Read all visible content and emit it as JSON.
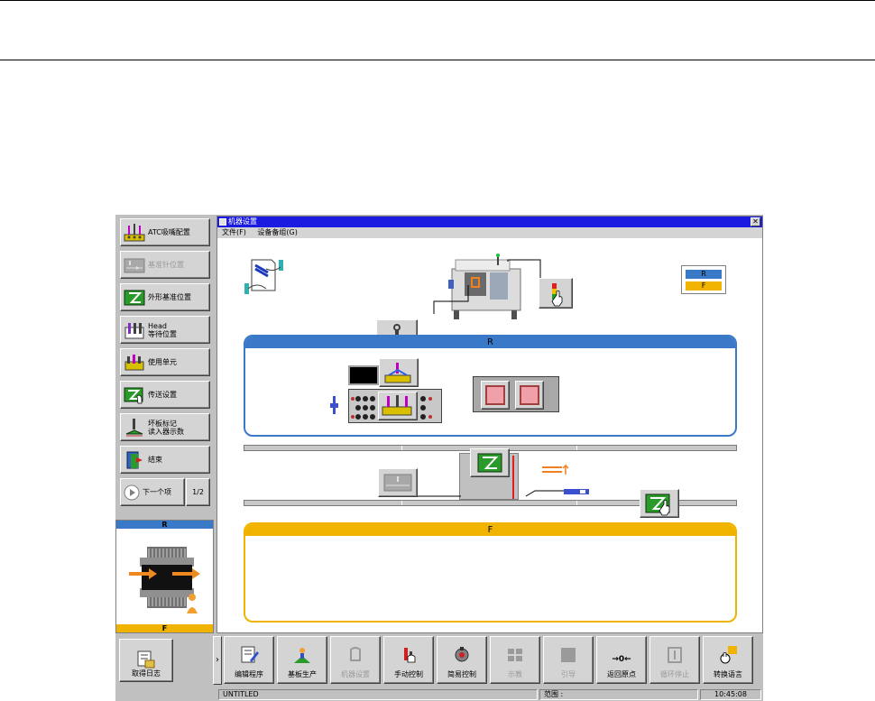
{
  "window": {
    "title": "机器设置",
    "close_glyph": "✕",
    "menu": [
      "文件(F)",
      "设备备组(G)"
    ]
  },
  "sidebar": {
    "items": [
      {
        "label": "ATC吸嘴配置",
        "icon": "nozzle-icon",
        "enabled": true
      },
      {
        "label": "基准针位置",
        "icon": "pin-icon",
        "enabled": false
      },
      {
        "label": "外形基准位置",
        "icon": "z-board-icon",
        "enabled": true
      },
      {
        "label": "Head\n等待位置",
        "icon": "head-icon",
        "enabled": true
      },
      {
        "label": "使用单元",
        "icon": "unit-icon",
        "enabled": true
      },
      {
        "label": "传送设置",
        "icon": "conveyor-icon",
        "enabled": true
      },
      {
        "label": "坏板标记\n读入器示数",
        "icon": "bad-mark-icon",
        "enabled": true
      },
      {
        "label": "结束",
        "icon": "exit-icon",
        "enabled": true
      }
    ],
    "next_label": "下一个项",
    "page_indicator": "1/2"
  },
  "preview": {
    "top_label": "R",
    "bottom_label": "F"
  },
  "legend": {
    "r": "R",
    "f": "F"
  },
  "panels": {
    "r_label": "R",
    "f_label": "F"
  },
  "toolbar": {
    "log_label": "取得日志",
    "arrow_glyph": "›",
    "buttons": [
      {
        "label": "编辑程序",
        "icon": "edit-program-icon",
        "enabled": true
      },
      {
        "label": "基板生产",
        "icon": "production-icon",
        "enabled": true
      },
      {
        "label": "机器设置",
        "icon": "machine-setup-icon",
        "enabled": false
      },
      {
        "label": "手动控制",
        "icon": "manual-control-icon",
        "enabled": true
      },
      {
        "label": "简易控制",
        "icon": "simple-control-icon",
        "enabled": true
      },
      {
        "label": "示教",
        "icon": "teach-icon",
        "enabled": false
      },
      {
        "label": "引导",
        "icon": "guide-icon",
        "enabled": false
      },
      {
        "label": "返回原点",
        "icon": "origin-return-icon",
        "enabled": true
      },
      {
        "label": "循环停止",
        "icon": "cycle-stop-icon",
        "enabled": false
      },
      {
        "label": "转换语言",
        "icon": "language-icon",
        "enabled": true
      }
    ],
    "origin_glyph": "→0←"
  },
  "status": {
    "program": "UNTITLED",
    "range_label": "范围 :",
    "time": "10:45:08"
  },
  "colors": {
    "r_blue": "#3a78c8",
    "f_yellow": "#f0b400",
    "title_blue": "#1a1ae0",
    "z_green": "#2a9a2a"
  }
}
